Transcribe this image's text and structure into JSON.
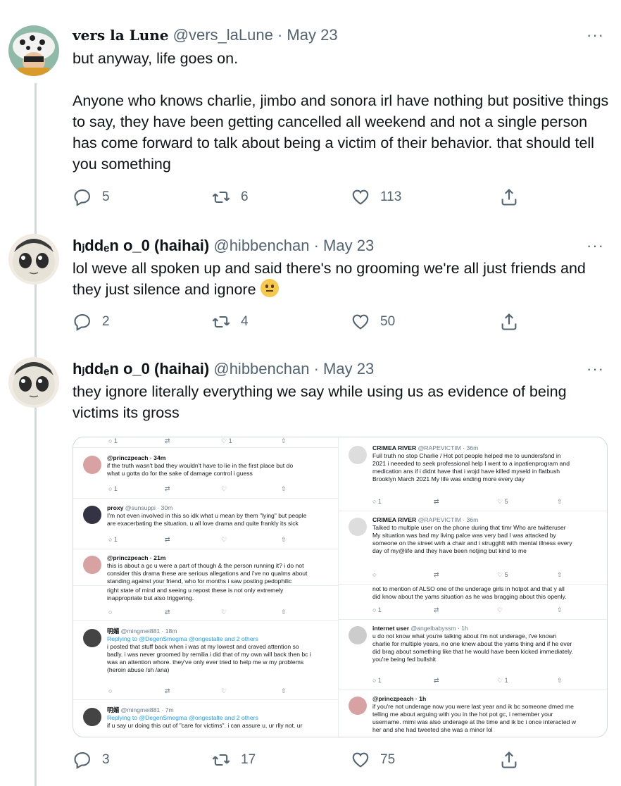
{
  "tweets": [
    {
      "display_name": "vers la Lune",
      "handle": "@vers_laLune",
      "date": "May 23",
      "more": "···",
      "paragraphs": [
        "but anyway, life goes on.",
        "Anyone who knows charlie, jimbo and sonora irl have nothing but positive things to say, they have been getting cancelled all weekend and not a single person has come forward to talk about being a victim of their behavior. that should tell you something"
      ],
      "replies": "5",
      "retweets": "6",
      "likes": "113"
    },
    {
      "display_name": "hⱼddₑn o_0 (haihai)",
      "handle": "@hibbenchan",
      "date": "May 23",
      "more": "···",
      "text": "lol weve all spoken up and said there's no grooming we're all just friends and they just silence and ignore",
      "emoji": "neutral-face",
      "replies": "2",
      "retweets": "4",
      "likes": "50"
    },
    {
      "display_name": "hⱼddₑn o_0 (haihai)",
      "handle": "@hibbenchan",
      "date": "May 23",
      "more": "···",
      "text": "they ignore literally everything  we say while using us as evidence of being victims its gross",
      "replies": "3",
      "retweets": "17",
      "likes": "75"
    }
  ],
  "media": {
    "left": [
      {
        "counts": [
          "1",
          "",
          "1",
          ""
        ]
      },
      {
        "name": "@princzpeach · 34m",
        "lines": [
          "if the truth wasn't bad they wouldn't have to lie in the first place but do",
          "what u gotta do for the sake of damage control i guess"
        ],
        "counts": [
          "1",
          "",
          "",
          ""
        ]
      },
      {
        "name": "proxy",
        "handle": "@sunsuppi · 30m",
        "lines": [
          "I'm not even involved in this so idk what u mean by them \"lying\" but people",
          "are exacerbating the situation, u all love drama and quite frankly its sick"
        ],
        "counts": [
          "1",
          "",
          "",
          ""
        ]
      },
      {
        "name": "@princzpeach · 21m",
        "lines": [
          "this is about a gc u were a part of though & the person running it? i do not",
          "consider this drama these are serious allegations and i've no qualms about",
          "standing against your friend, who for months i saw posting pedophilic"
        ]
      },
      {
        "lines": [
          "right state of mind and seeing u repost these is not only extremely",
          "inappropriate but also triggering."
        ]
      },
      {
        "name": "明媚",
        "handle": "@mingmei881 · 18m",
        "reply_to": "Replying to @DegenSmegma @ongestalte and 2 others",
        "lines": [
          "i posted that stuff back when i was at my lowest and craved attention so",
          "badly. i was never groomed by remilia i did that of my own will back then bc i",
          "was an attention whore. they've only ever tried to help me w my problems",
          "(heroin abuse /sh /ana)"
        ]
      },
      {
        "name": "明媚",
        "handle": "@mingmei881 · 7m",
        "reply_to": "Replying to @DegenSmegma @ongestalte and 2 others",
        "lines": [
          "if u say ur doing this out of \"care for victims\". i can assure u, ur rlly not. ur"
        ]
      }
    ],
    "right": [
      {
        "name": "CRIMEA RIVER",
        "handle": "@RAPEVICTIM · 36m",
        "lines": [
          "Full truth no stop Charlie / Hot pot people  helped me to uundersfsnd in",
          "2021 i neeeded to  seek professional help  I went to a inpatienprogram and",
          "medication ans  if i  didnt have that i wojd have killed myseld in flatbush",
          "Brooklyn March 2021 My life was ending more every day"
        ],
        "counts": [
          "1",
          "",
          "5",
          ""
        ]
      },
      {
        "name": "CRIMEA RIVER",
        "handle": "@RAPEVICTIM · 36m",
        "lines": [
          "Talked to multiple user on the phone during that timr Who are twitteruser",
          "My situation was bad my  living palce was very bad I was attacked by",
          "someone on the street wirh a chair and  i strugghlt with mental illness every",
          "day of my@life and they  have been notjing but kind to me"
        ],
        "counts": [
          "",
          "",
          "5",
          ""
        ]
      },
      {
        "lines": [
          "not to mention of ALSO one of the underage girls in hotpot and that y all",
          "did know about the yams situation as he was bragging about this openly."
        ],
        "counts": [
          "1",
          "",
          "",
          ""
        ]
      },
      {
        "name": "internet user",
        "handle": "@angelbabyssm · 1h",
        "lines": [
          "u do not know what you're talking about i'm not underage, i've known",
          "charlie for multiple years, no one knew about the yams thing and if he ever",
          "did brag about something like that he would have been kicked immediately.",
          "you're being fed bullshit"
        ],
        "counts": [
          "1",
          "",
          "1",
          ""
        ]
      },
      {
        "name": "@princzpeach · 1h",
        "lines": [
          "if you're not underage now you were last year and ik bc someone dmed me",
          "telling me about arguing with you in the hot pot gc, i remember your",
          "username. mimi was also underage at the time and ik bc i once interacted w",
          "her and she had tweeted she was a minor lol"
        ]
      }
    ]
  },
  "colors": {
    "text": "#0f1419",
    "secondary": "#536471",
    "line": "#cfd9de",
    "link": "#1d9bf0"
  }
}
